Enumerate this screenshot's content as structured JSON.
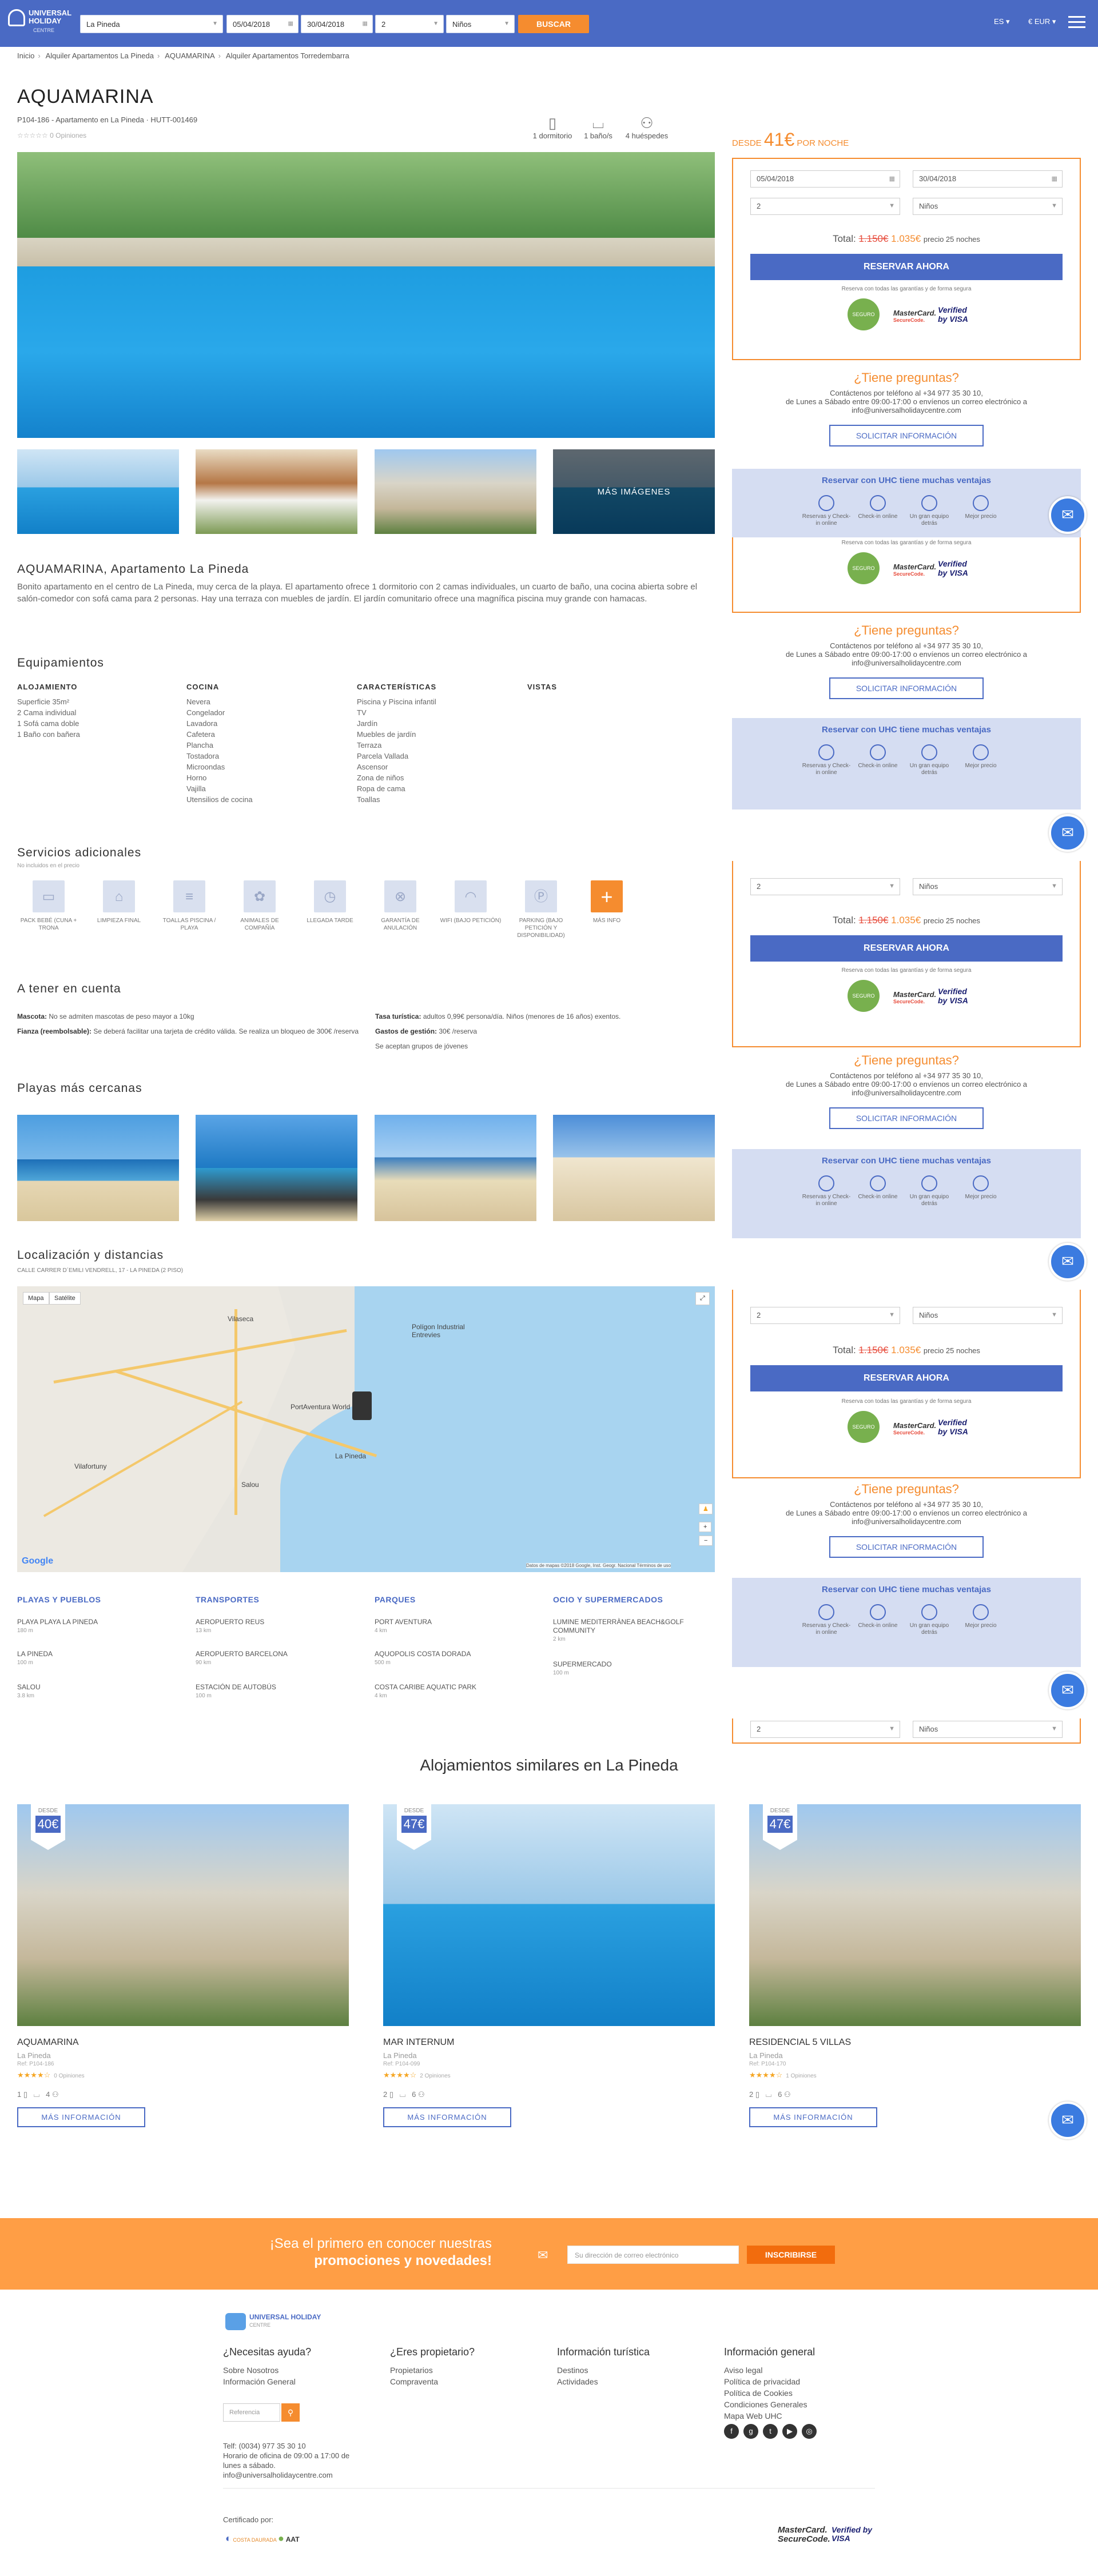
{
  "topbar": {
    "logo": {
      "line1": "UNIVERSAL",
      "line2": "HOLIDAY",
      "line3": "CENTRE"
    },
    "destination": "La Pineda",
    "checkin": "05/04/2018",
    "checkout": "30/04/2018",
    "guests": "2",
    "children": "Niños",
    "search_label": "BUSCAR",
    "language": "ES",
    "currency": "€ EUR"
  },
  "breadcrumb": [
    "Inicio",
    "Alquiler Apartamentos La Pineda",
    "AQUAMARINA",
    "Alquiler Apartamentos Torredembarra"
  ],
  "property": {
    "title": "AQUAMARINA",
    "subtitle": "P104-186 - Apartamento en La Pineda · HUTT-001469",
    "rating_text": "0 Opiniones",
    "facts": [
      {
        "icon": "door-icon",
        "label": "1 dormitorio"
      },
      {
        "icon": "bath-icon",
        "label": "1 baño/s"
      },
      {
        "icon": "guests-icon",
        "label": "4 huéspedes"
      }
    ],
    "more_images": "MÁS IMÁGENES",
    "desc_title": "AQUAMARINA, Apartamento La Pineda",
    "description": "Bonito apartamento en el centro de La Pineda, muy cerca de la playa. El apartamento ofrece 1 dormitorio con 2 camas individuales, un cuarto de baño, una cocina abierta sobre el salón-comedor con sofá cama para 2 personas. Hay una terraza con muebles de jardín. El jardín comunitario ofrece una magnífica piscina muy grande con hamacas."
  },
  "equipment": {
    "title": "Equipamientos",
    "columns": [
      {
        "head": "ALOJAMIENTO",
        "items": [
          "Superficie 35m²",
          "2 Cama individual",
          "1 Sofá cama doble",
          "1 Baño con bañera"
        ]
      },
      {
        "head": "COCINA",
        "items": [
          "Nevera",
          "Congelador",
          "Lavadora",
          "Cafetera",
          "Plancha",
          "Tostadora",
          "Microondas",
          "Horno",
          "Vajilla",
          "Utensilios de cocina"
        ]
      },
      {
        "head": "CARACTERÍSTICAS",
        "items": [
          "Piscina y Piscina infantil",
          "TV",
          "Jardín",
          "Muebles de jardín",
          "Terraza",
          "Parcela Vallada",
          "Ascensor",
          "Zona de niños",
          "Ropa de cama",
          "Toallas"
        ]
      },
      {
        "head": "VISTAS",
        "items": []
      }
    ]
  },
  "services": {
    "title": "Servicios adicionales",
    "subtitle": "No incluidos en el precio",
    "items": [
      "PACK BEBÉ (CUNA + TRONA",
      "LIMPIEZA FINAL",
      "TOALLAS PISCINA / PLAYA",
      "ANIMALES DE COMPAÑÍA",
      "LLEGADA TARDE",
      "GARANTÍA DE ANULACIÓN",
      "WIFI (BAJO PETICIÓN)",
      "PARKING (BAJO PETICIÓN Y DISPONIBILIDAD)",
      "MÁS INFO"
    ]
  },
  "notes": {
    "title": "A tener en cuenta",
    "pets_label": "Mascota:",
    "pets": "No se admiten mascotas de peso mayor a 10kg",
    "deposit_label": "Fianza (reembolsable):",
    "deposit": "Se deberá facilitar una tarjeta de crédito válida. Se realiza un bloqueo de 300€ /reserva",
    "tax_label": "Tasa turística:",
    "tax": "adultos 0,99€ persona/día. Niños (menores de 16 años) exentos.",
    "mgmt_label": "Gastos de gestión:",
    "mgmt": "30€ /reserva",
    "groups": "Se aceptan grupos de jóvenes"
  },
  "beaches": {
    "title": "Playas más cercanas"
  },
  "location": {
    "title": "Localización y distancias",
    "address": "CALLE CARRER D´EMILI VENDRELL, 17 - LA PINEDA (2 PISO)",
    "map_type_map": "Mapa",
    "map_type_sat": "Satélite",
    "map_labels": [
      "Vilaseca",
      "Polígon Industrial Entrevies",
      "PortAventura World",
      "La Pineda",
      "Vilafortuny",
      "Salou"
    ],
    "map_footer": "Datos de mapas ©2018 Google, Inst. Geogr. Nacional   Términos de uso",
    "google": "Google"
  },
  "distances": [
    {
      "head": "PLAYAS Y PUEBLOS",
      "items": [
        {
          "n": "PLAYA PLAYA LA PINEDA",
          "d": "180 m"
        },
        {
          "n": "LA PINEDA",
          "d": "100 m"
        },
        {
          "n": "SALOU",
          "d": "3.8 km"
        }
      ]
    },
    {
      "head": "TRANSPORTES",
      "items": [
        {
          "n": "AEROPUERTO REUS",
          "d": "13 km"
        },
        {
          "n": "AEROPUERTO BARCELONA",
          "d": "90 km"
        },
        {
          "n": "ESTACIÓN DE AUTOBÚS",
          "d": "100 m"
        }
      ]
    },
    {
      "head": "PARQUES",
      "items": [
        {
          "n": "PORT AVENTURA",
          "d": "4 km"
        },
        {
          "n": "AQUOPOLIS COSTA DORADA",
          "d": "500 m"
        },
        {
          "n": "COSTA CARIBE AQUATIC PARK",
          "d": "4 km"
        }
      ]
    },
    {
      "head": "OCIO Y SUPERMERCADOS",
      "items": [
        {
          "n": "LUMINE MEDITERRÀNEA BEACH&GOLF COMMUNITY",
          "d": "2 km"
        },
        {
          "n": "SUPERMERCADO",
          "d": "100 m"
        }
      ]
    }
  ],
  "similar": {
    "title": "Alojamientos similares en La Pineda",
    "desde": "DESDE",
    "button": "MÁS INFORMACIÓN",
    "cards": [
      {
        "price": "40€",
        "name": "AQUAMARINA",
        "loc": "La Pineda",
        "ref": "Ref: P104-186",
        "stars": "★★★★☆",
        "reviews": "0 Opiniones",
        "rooms": "1",
        "guests": "4"
      },
      {
        "price": "47€",
        "name": "MAR INTERNUM",
        "loc": "La Pineda",
        "ref": "Ref: P104-099",
        "stars": "★★★★☆",
        "reviews": "2 Opiniones",
        "rooms": "2",
        "guests": "6"
      },
      {
        "price": "47€",
        "name": "RESIDENCIAL 5 VILLAS",
        "loc": "La Pineda",
        "ref": "Ref: P104-170",
        "stars": "★★★★☆",
        "reviews": "1 Opiniones",
        "rooms": "2",
        "guests": "6"
      }
    ]
  },
  "newsletter": {
    "line1": "¡Sea el primero en conocer nuestras",
    "line2": "promociones y novedades!",
    "placeholder": "Su dirección de correo electrónico",
    "button": "INSCRIBIRSE"
  },
  "footer": {
    "logo": "UNIVERSAL HOLIDAY",
    "logo_sub": "CENTRE",
    "cols": [
      {
        "head": "¿Necesitas ayuda?",
        "items": [
          "Sobre Nosotros",
          "Información General"
        ]
      },
      {
        "head": "¿Eres propietario?",
        "items": [
          "Propietarios",
          "Compraventa"
        ]
      },
      {
        "head": "Información turística",
        "items": [
          "Destinos",
          "Actividades"
        ]
      },
      {
        "head": "Información general",
        "items": [
          "Aviso legal",
          "Política de privacidad",
          "Política de Cookies",
          "Condiciones Generales",
          "Mapa Web UHC"
        ]
      }
    ],
    "ref_placeholder": "Referencia",
    "contact": [
      "Telf: (0034) 977 35 30 10",
      "Horario de oficina de 09:00 a 17:00 de",
      "lunes a sábado.",
      "info@universalholidaycentre.com"
    ],
    "certified": "Certificado por:",
    "cert1": "COSTA DAURADA",
    "cert2": "AAT",
    "mastercard": "MasterCard.",
    "securecode": "SecureCode.",
    "visa": "Verified by VISA"
  },
  "sidebar": {
    "desde": "DESDE",
    "price": "41€",
    "per": "POR NOCHE",
    "checkin": "05/04/2018",
    "checkout": "30/04/2018",
    "guests": "2",
    "children": "Niños",
    "total_label": "Total:",
    "old_price": "1.150€",
    "new_price": "1.035€",
    "total_note": "precio 25 noches",
    "reserve": "RESERVAR AHORA",
    "guarantee": "Reserva con todas las garantías y de forma segura",
    "seal": "SEGURO",
    "mc": "MasterCard.",
    "mc2": "SecureCode.",
    "visa": "Verified by VISA",
    "faq_q": "¿Tiene preguntas?",
    "faq_t1": "Contáctenos por teléfono al +34 977 35 30 10,",
    "faq_t2": "de Lunes a Sábado entre 09:00-17:00 o envíenos un correo electrónico a",
    "faq_t3": "info@universalholidaycentre.com",
    "faq_btn": "SOLICITAR INFORMACIÓN",
    "adv_title": "Reservar con UHC tiene muchas ventajas",
    "adv_items": [
      "Reservas y Check-in online",
      "Check-in online",
      "Un gran equipo detrás",
      "Mejor precio"
    ]
  }
}
